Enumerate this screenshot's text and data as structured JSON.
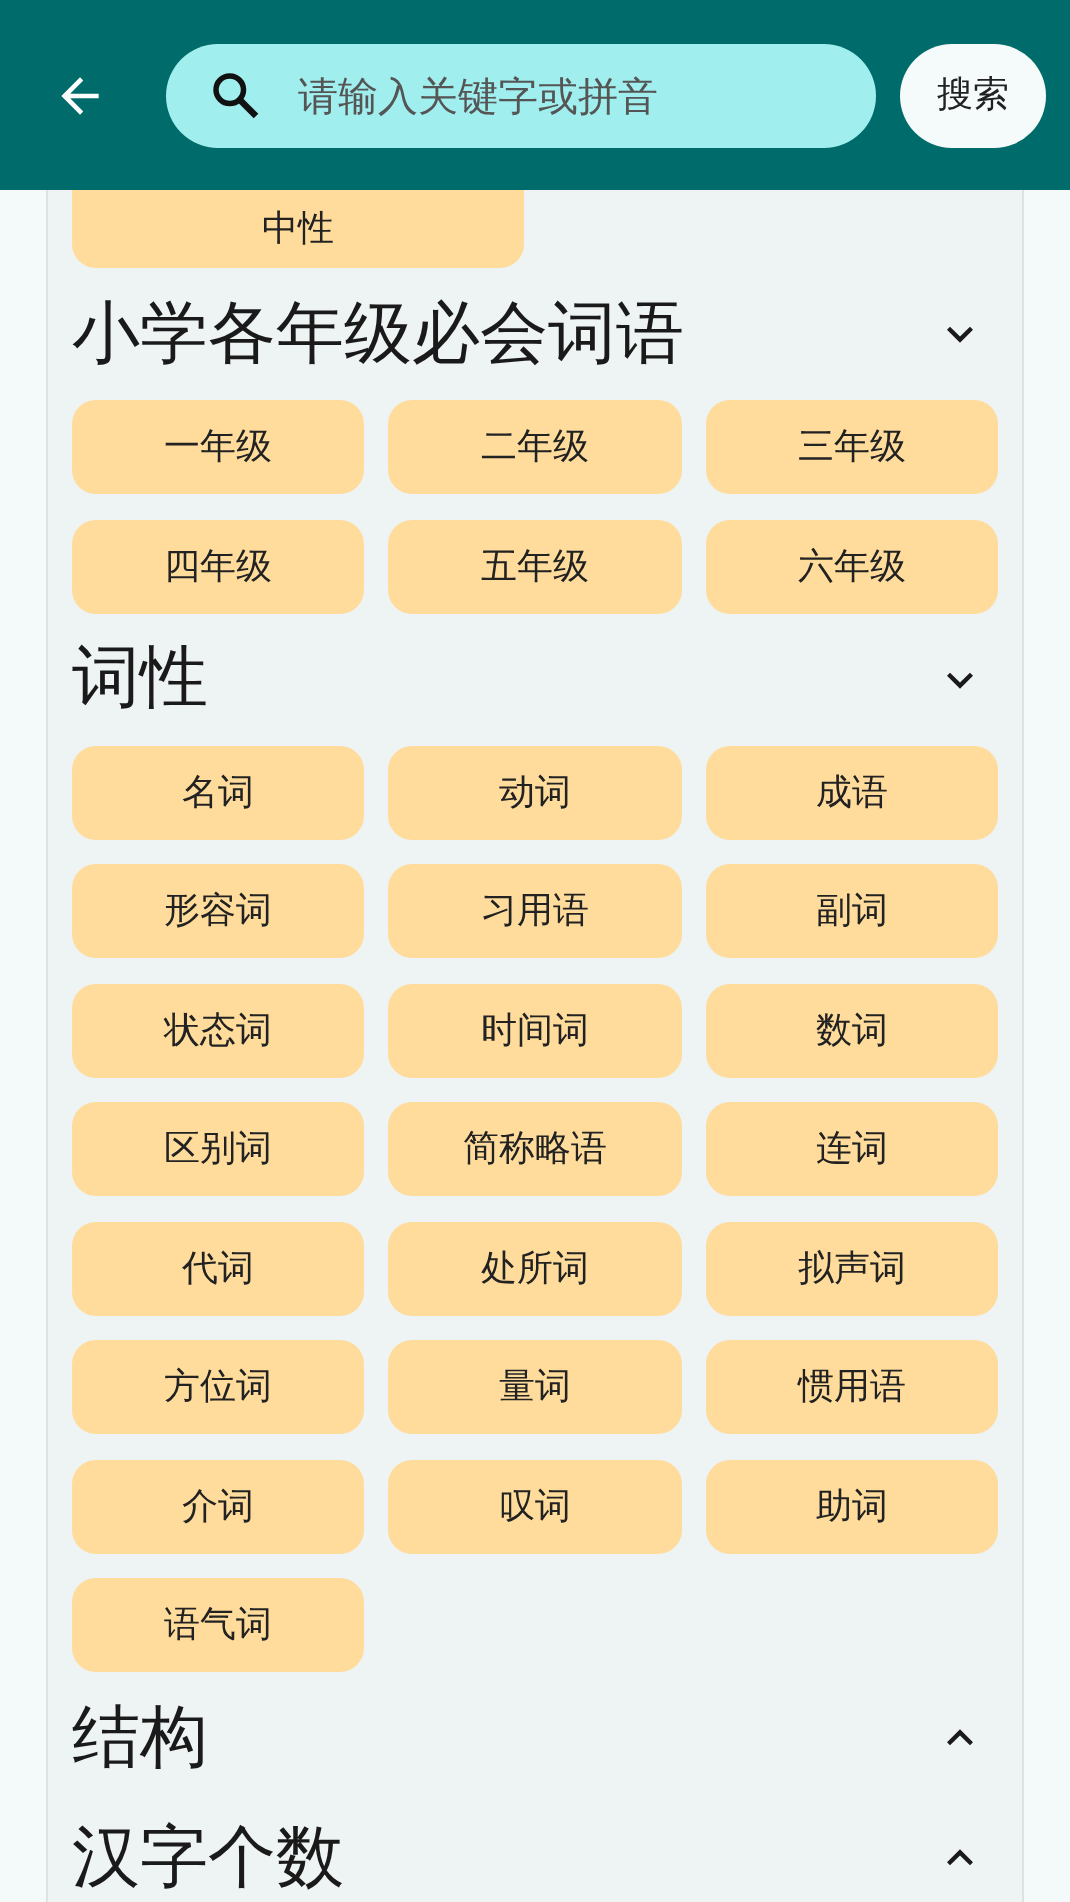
{
  "search": {
    "placeholder": "请输入关键字或拼音",
    "button": "搜索"
  },
  "top_chips": [
    "中性"
  ],
  "sections": [
    {
      "title": "小学各年级必会词语",
      "expanded": true,
      "chips": [
        "一年级",
        "二年级",
        "三年级",
        "四年级",
        "五年级",
        "六年级"
      ]
    },
    {
      "title": "词性",
      "expanded": true,
      "chips": [
        "名词",
        "动词",
        "成语",
        "形容词",
        "习用语",
        "副词",
        "状态词",
        "时间词",
        "数词",
        "区别词",
        "简称略语",
        "连词",
        "代词",
        "处所词",
        "拟声词",
        "方位词",
        "量词",
        "惯用语",
        "介词",
        "叹词",
        "助词",
        "语气词"
      ]
    },
    {
      "title": "结构",
      "expanded": false
    },
    {
      "title": "汉字个数",
      "expanded": false
    }
  ]
}
